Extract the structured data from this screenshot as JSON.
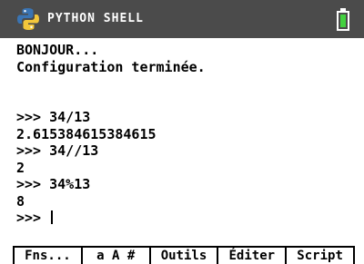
{
  "window": {
    "title": "PYTHON SHELL",
    "logo_icon": "python-logo-icon",
    "battery_icon": "battery-icon",
    "battery_level": 1.0,
    "colors": {
      "titlebar_bg": "#4b4b4b",
      "title_text": "#ffffff",
      "battery_fill": "#43d13f"
    }
  },
  "console": {
    "lines": [
      "BONJOUR...",
      "Configuration terminée.",
      "",
      "",
      ">>> 34/13",
      "2.615384615384615",
      ">>> 34//13",
      "2",
      ">>> 34%13",
      "8",
      ">>> "
    ]
  },
  "menu": {
    "items": [
      "Fns...",
      "a A #",
      "Outils",
      "Éditer",
      "Script"
    ]
  }
}
